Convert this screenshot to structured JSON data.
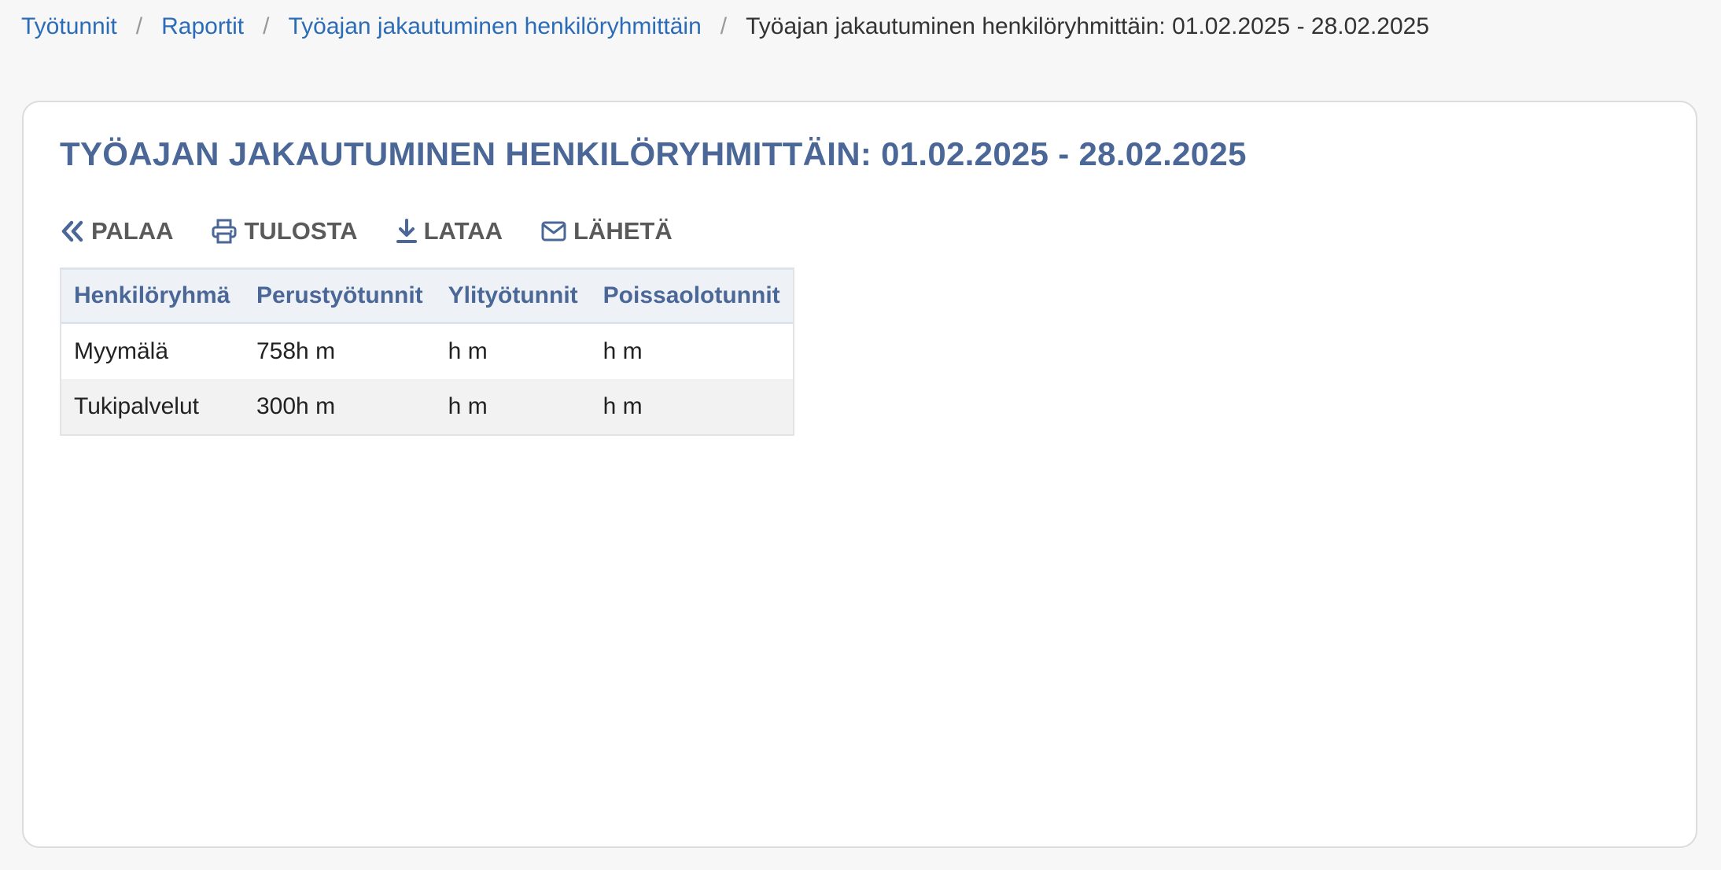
{
  "breadcrumb": {
    "items": [
      "Työtunnit",
      "Raportit",
      "Työajan jakautuminen henkilöryhmittäin"
    ],
    "separator": "/",
    "current": "Työajan jakautuminen henkilöryhmittäin: 01.02.2025 - 28.02.2025"
  },
  "page": {
    "title": "TYÖAJAN JAKAUTUMINEN HENKILÖRYHMITTÄIN: 01.02.2025 - 28.02.2025"
  },
  "toolbar": {
    "back_label": "PALAA",
    "back_icon": "double-chevron-left-icon",
    "print_label": "TULOSTA",
    "print_icon": "printer-icon",
    "download_label": "LATAA",
    "download_icon": "download-icon",
    "send_label": "LÄHETÄ",
    "send_icon": "envelope-icon"
  },
  "table": {
    "headers": [
      "Henkilöryhmä",
      "Perustyötunnit",
      "Ylityötunnit",
      "Poissaolotunnit"
    ],
    "rows": [
      [
        "Myymälä",
        "758h m",
        "h m",
        "h m"
      ],
      [
        "Tukipalvelut",
        "300h m",
        "h m",
        "h m"
      ]
    ]
  },
  "colors": {
    "accent": "#4a6797",
    "link": "#2b6cb8",
    "background": "#f7f7f7",
    "card": "#ffffff"
  }
}
